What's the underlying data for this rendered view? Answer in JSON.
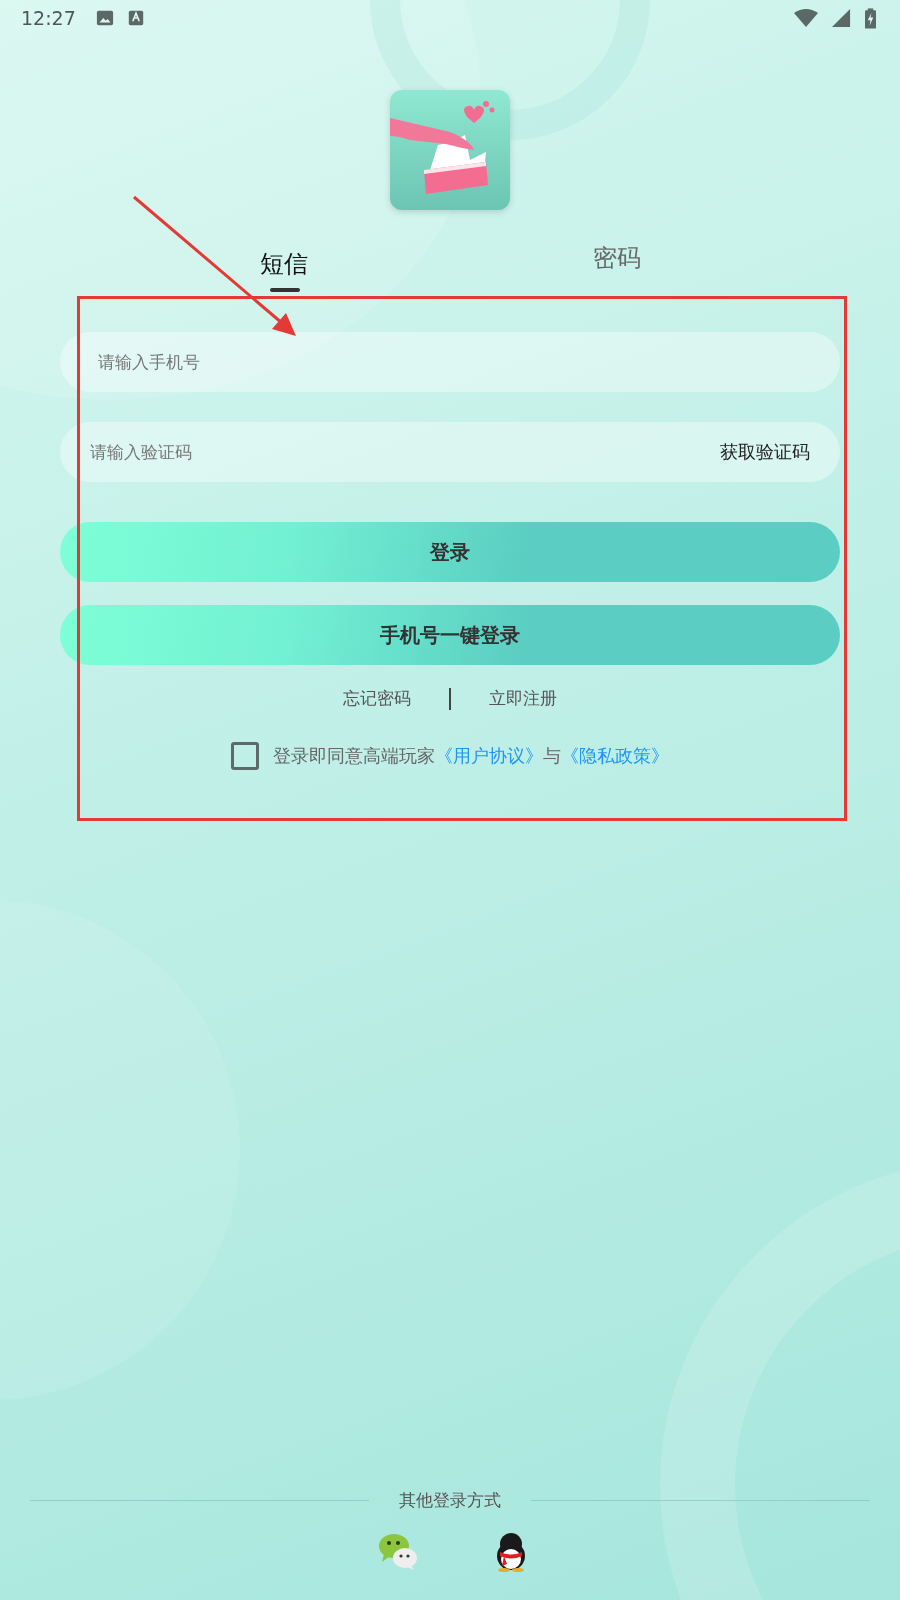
{
  "status_bar": {
    "time": "12:27"
  },
  "tabs": [
    {
      "label": "短信",
      "selected": true
    },
    {
      "label": "密码",
      "selected": false
    }
  ],
  "phone_field": {
    "placeholder": "请输入手机号"
  },
  "code_field": {
    "placeholder": "请输入验证码",
    "action": "获取验证码"
  },
  "login_button": "登录",
  "one_click_button": "手机号一键登录",
  "links": [
    "忘记密码",
    "立即注册"
  ],
  "agreement": {
    "checked": false,
    "text": "登录即同意高端玩家",
    "link_1": "《用户协议》",
    "joiner": "与",
    "link_2": "《隐私政策》"
  },
  "other_login": {
    "label": "其他登录方式"
  }
}
